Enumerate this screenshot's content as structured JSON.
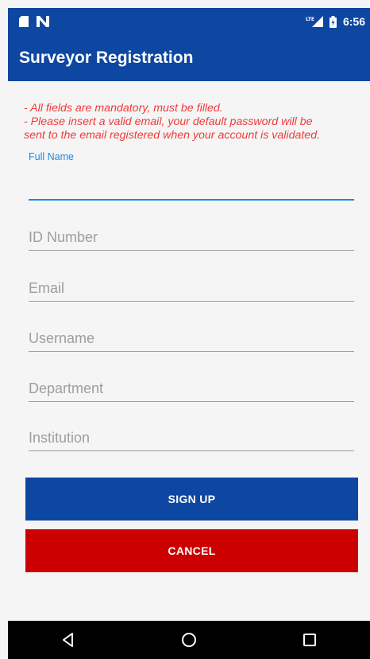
{
  "status_bar": {
    "time": "6:56",
    "network_label": "LTE",
    "icons": [
      "sd-card-icon",
      "n-notification-icon",
      "lte-signal-icon",
      "battery-icon"
    ]
  },
  "app_bar": {
    "title": "Surveyor Registration"
  },
  "notice": {
    "line1": "- All fields are mandatory, must be filled.",
    "line2": "- Please insert a valid email, your default password will be",
    "line3": "sent to the email registered when your account is validated."
  },
  "form": {
    "full_name": {
      "label": "Full Name",
      "value": "",
      "placeholder": ""
    },
    "id_number": {
      "value": "",
      "placeholder": "ID Number"
    },
    "email": {
      "value": "",
      "placeholder": "Email"
    },
    "username": {
      "value": "",
      "placeholder": "Username"
    },
    "department": {
      "value": "",
      "placeholder": "Department"
    },
    "institution": {
      "value": "",
      "placeholder": "Institution"
    }
  },
  "buttons": {
    "sign_up": "SIGN UP",
    "cancel": "CANCEL"
  },
  "colors": {
    "primary": "#0d47a1",
    "accent": "#1e88e5",
    "error_text": "#f03a3a",
    "cancel": "#cc0000",
    "background": "#f5f5f5"
  },
  "nav_bar": {
    "icons": [
      "back-icon",
      "home-icon",
      "recents-icon"
    ]
  }
}
